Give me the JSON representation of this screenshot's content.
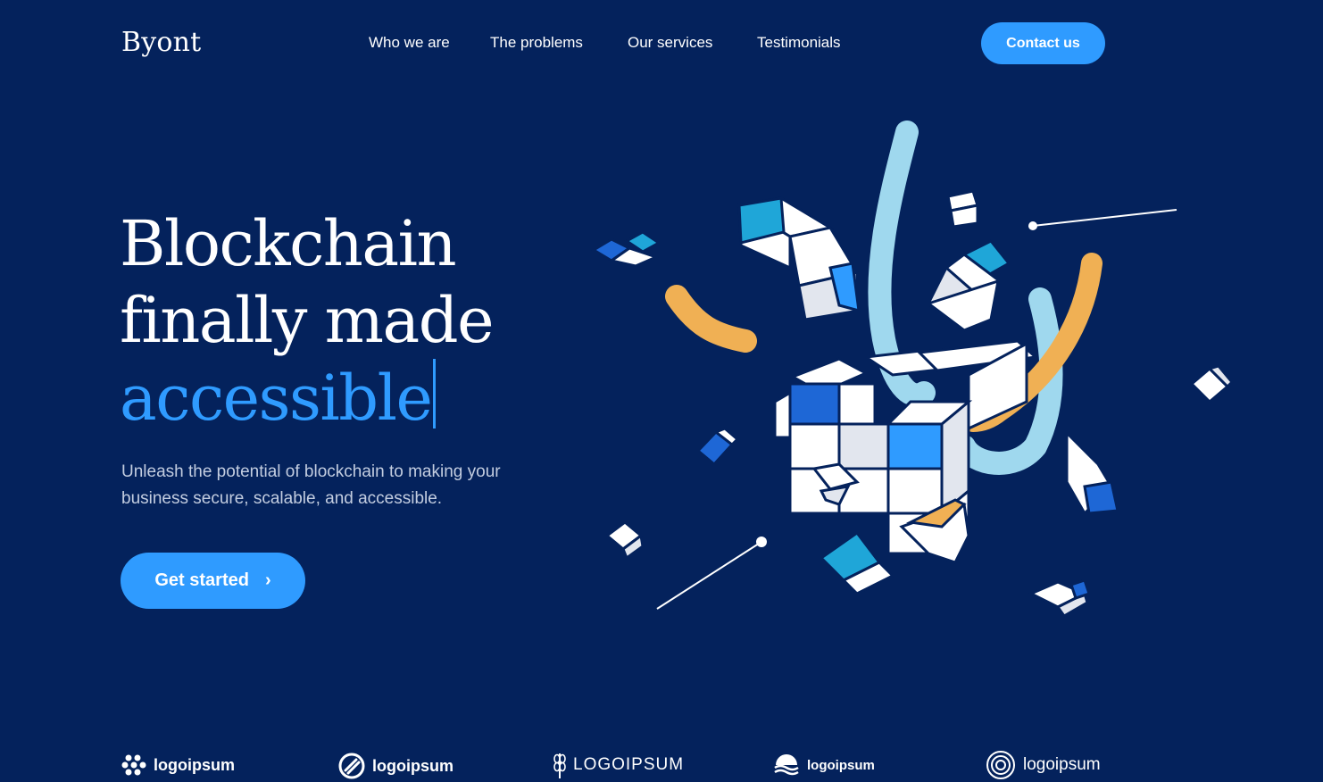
{
  "brand": {
    "name": "Byont"
  },
  "nav": {
    "items": [
      {
        "label": "Who we are"
      },
      {
        "label": "The problems"
      },
      {
        "label": "Our services"
      },
      {
        "label": "Testimonials"
      }
    ],
    "contact_label": "Contact us"
  },
  "hero": {
    "title_line1": "Blockchain",
    "title_line2": "finally made",
    "title_accent": "accessible",
    "subtitle": "Unleash the potential of blockchain to making your business secure, scalable, and  accessible.",
    "cta_label": "Get started",
    "cta_icon": "chevron-right-icon"
  },
  "partners": {
    "logos": [
      {
        "text": "logoipsum",
        "icon": "dots-logo-icon"
      },
      {
        "text": "logoipsum",
        "icon": "circle-stripe-logo-icon"
      },
      {
        "text": "LOGOIPSUM",
        "icon": "wheat-logo-icon"
      },
      {
        "text": "logoipsum",
        "icon": "wave-logo-icon"
      },
      {
        "text": "logoipsum",
        "icon": "spiral-logo-icon"
      }
    ]
  },
  "colors": {
    "background": "#04225c",
    "accent": "#2f9bff",
    "orange": "#f0b054",
    "light_blue": "#9fd8ee",
    "cube_blue": "#1e67d6",
    "cube_cyan": "#1fa6d8"
  }
}
